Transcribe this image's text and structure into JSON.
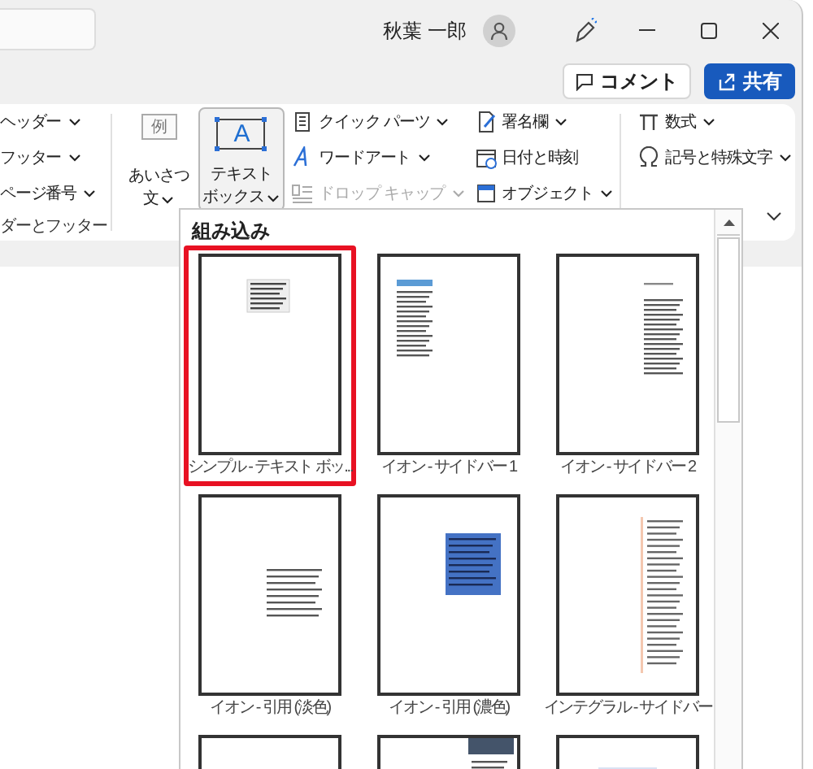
{
  "title_bar": {
    "user_name": "秋葉 一郎"
  },
  "actions": [
    {
      "label": "コメント",
      "kind": "outline"
    },
    {
      "label": "共有",
      "kind": "primary"
    }
  ],
  "ribbon": {
    "groups": [
      {
        "columns": [
          [
            {
              "label": "ヘッダー",
              "dropdown": true,
              "disabled": false
            },
            {
              "label": "フッター",
              "dropdown": true,
              "disabled": false
            },
            {
              "label": "ページ番号",
              "dropdown": true,
              "disabled": false
            }
          ]
        ],
        "label": "ダーとフッター"
      },
      {
        "large_buttons": [
          {
            "icon_text": "例",
            "lines": [
              "あいさつ",
              "文"
            ],
            "dropdown": true,
            "selected": false
          },
          {
            "icon_text": "A",
            "lines": [
              "テキスト",
              "ボックス"
            ],
            "dropdown": true,
            "selected": true
          }
        ],
        "columns": [
          [
            {
              "label": "クイック パーツ",
              "dropdown": true,
              "disabled": false
            },
            {
              "label": "ワードアート",
              "dropdown": true,
              "disabled": false
            },
            {
              "label": "ドロップ キャップ",
              "dropdown": true,
              "disabled": true
            }
          ],
          [
            {
              "label": "署名欄",
              "dropdown": true,
              "disabled": false
            },
            {
              "label": "日付と時刻",
              "dropdown": false,
              "disabled": false
            },
            {
              "label": "オブジェクト",
              "dropdown": true,
              "disabled": false
            }
          ]
        ]
      },
      {
        "columns": [
          [
            {
              "label": "数式",
              "dropdown": true,
              "disabled": false
            },
            {
              "label": "記号と特殊文字",
              "dropdown": true,
              "disabled": false
            }
          ]
        ]
      }
    ]
  },
  "gallery": {
    "heading": "組み込み",
    "items": [
      {
        "label": "シンプル - テキスト ボッ...",
        "selected": true,
        "kind": "box-top"
      },
      {
        "label": "イオン - サイドバー 1",
        "selected": false,
        "kind": "sidebar-left"
      },
      {
        "label": "イオン - サイドバー 2",
        "selected": false,
        "kind": "sidebar-right"
      },
      {
        "label": "イオン - 引用 (淡色)",
        "selected": false,
        "kind": "quote-light"
      },
      {
        "label": "イオン - 引用 (濃色)",
        "selected": false,
        "kind": "quote-dark"
      },
      {
        "label": "インテグラル - サイドバー",
        "selected": false,
        "kind": "sidebar-bar"
      },
      {
        "selected": false,
        "kind": "blank"
      },
      {
        "selected": false,
        "kind": "sidebar-dark"
      },
      {
        "selected": false,
        "kind": "header-lines"
      }
    ]
  }
}
